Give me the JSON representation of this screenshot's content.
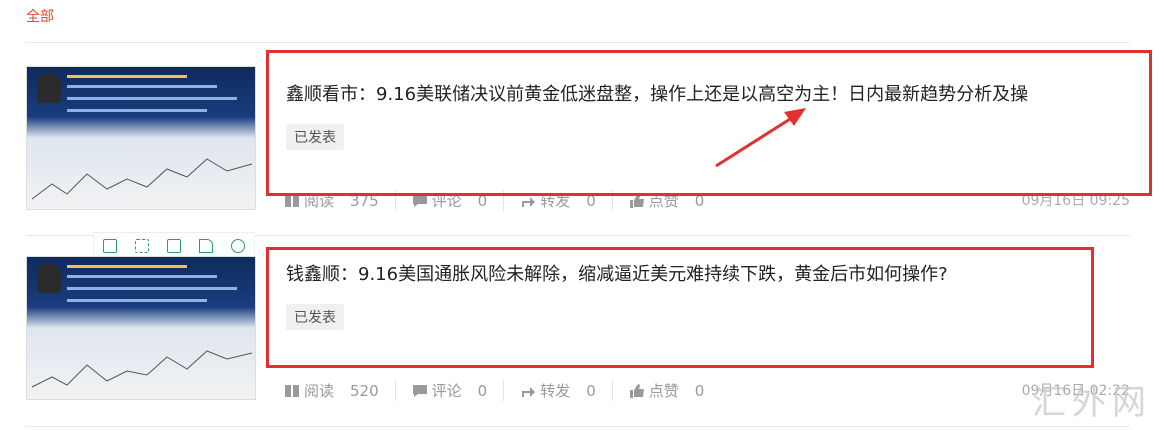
{
  "tabs": {
    "all": "全部"
  },
  "stat_labels": {
    "read": "阅读",
    "comment": "评论",
    "forward": "转发",
    "like": "点赞"
  },
  "articles": [
    {
      "title": "鑫顺看市：9.16美联储决议前黄金低迷盘整，操作上还是以高空为主！日内最新趋势分析及操",
      "status": "已发表",
      "read": "375",
      "comment": "0",
      "forward": "0",
      "like": "0",
      "date": "09月16日 09:25"
    },
    {
      "title": "钱鑫顺：9.16美国通胀风险未解除，缩减逼近美元难持续下跌，黄金后市如何操作?",
      "status": "已发表",
      "read": "520",
      "comment": "0",
      "forward": "0",
      "like": "0",
      "date": "09月16日 02:22"
    }
  ],
  "watermark": "汇外网",
  "colors": {
    "accent": "#e2472f",
    "highlight_box": "#e03131",
    "toolbar_icon": "#2e9e62"
  },
  "icons": [
    "phone-icon",
    "expand-icon",
    "save-icon",
    "share-icon",
    "settings-icon",
    "read-icon",
    "comment-icon",
    "forward-icon",
    "like-icon"
  ]
}
